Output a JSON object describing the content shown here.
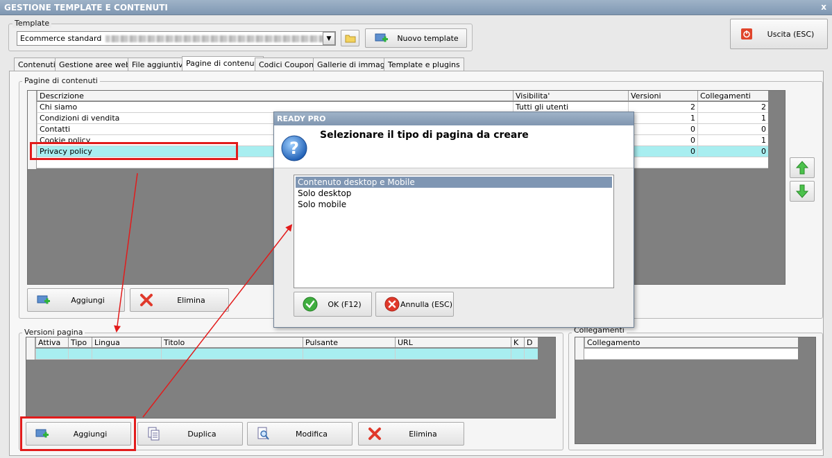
{
  "window": {
    "title": "GESTIONE TEMPLATE E CONTENUTI",
    "close_glyph": "x"
  },
  "template": {
    "group_label": "Template",
    "combo_value": "Ecommerce standard",
    "new_button": "Nuovo template"
  },
  "exit_button": "Uscita (ESC)",
  "tabs": [
    {
      "label": "Contenuti",
      "active": false
    },
    {
      "label": "Gestione aree web",
      "active": false
    },
    {
      "label": "File aggiuntivi",
      "active": false
    },
    {
      "label": "Pagine di contenuti",
      "active": true
    },
    {
      "label": "Codici Coupon",
      "active": false
    },
    {
      "label": "Gallerie di immagini",
      "active": false
    },
    {
      "label": "Template e plugins",
      "active": false
    }
  ],
  "pages": {
    "group_label": "Pagine di contenuti",
    "columns": [
      "Descrizione",
      "Visibilita'",
      "Versioni",
      "Collegamenti"
    ],
    "rows": [
      {
        "descrizione": "Chi siamo",
        "visibilita": "Tutti gli utenti",
        "versioni": "2",
        "collegamenti": "2"
      },
      {
        "descrizione": "Condizioni di vendita",
        "visibilita": "",
        "versioni": "1",
        "collegamenti": "1"
      },
      {
        "descrizione": "Contatti",
        "visibilita": "",
        "versioni": "0",
        "collegamenti": "0"
      },
      {
        "descrizione": "Cookie policy",
        "visibilita": "",
        "versioni": "0",
        "collegamenti": "1"
      },
      {
        "descrizione": "Privacy policy",
        "visibilita": "",
        "versioni": "0",
        "collegamenti": "0"
      }
    ],
    "add_button": "Aggiungi",
    "delete_button": "Elimina"
  },
  "versions": {
    "group_label": "Versioni pagina",
    "columns": [
      "Attiva",
      "Tipo",
      "Lingua",
      "Titolo",
      "Pulsante",
      "URL",
      "K",
      "D"
    ],
    "add_button": "Aggiungi",
    "duplicate_button": "Duplica",
    "edit_button": "Modifica",
    "delete_button": "Elimina"
  },
  "links": {
    "group_label": "Collegamenti",
    "columns": [
      "Collegamento"
    ]
  },
  "dialog": {
    "title": "READY PRO",
    "question": "Selezionare il tipo di pagina da creare",
    "options": [
      "Contenuto desktop e Mobile",
      "Solo desktop",
      "Solo mobile"
    ],
    "selected_index": 0,
    "ok_button": "OK (F12)",
    "cancel_button": "Annulla (ESC)"
  },
  "colors": {
    "accent_title": "#8aa0bb",
    "selected_row": "#a8eef0",
    "annotation": "#e21b1b"
  }
}
